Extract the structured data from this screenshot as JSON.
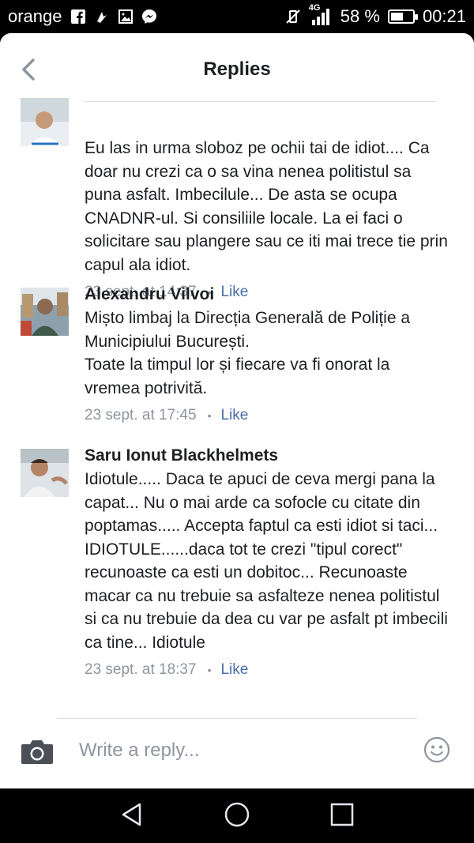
{
  "status_bar": {
    "carrier": "orange",
    "network": "4G",
    "battery_text": "58 %",
    "battery_level": 0.58,
    "time": "00:21"
  },
  "header": {
    "title": "Replies",
    "back_icon": "chevron-left-icon"
  },
  "comments": [
    {
      "author": "",
      "text": "Eu las in urma sloboz pe ochii tai de idiot.... Ca doar nu crezi ca o sa vina nenea politistul sa puna asfalt. Imbecilule... De asta se ocupa CNADNR-ul. Si consiliile locale. La ei faci o solicitare sau plangere sau ce iti mai trece tie prin capul ala idiot.",
      "time": "23 sept. at 14:37",
      "separator": "•",
      "like": "Like"
    },
    {
      "author": "Alexandru Vilvoi",
      "text": "Mișto limbaj la Direcția Generală de Poliție a Municipiului București.\nToate la timpul lor și fiecare va fi onorat la vremea potrivită.",
      "time": "23 sept. at 17:45",
      "separator": "•",
      "like": "Like"
    },
    {
      "author": "Saru Ionut Blackhelmets",
      "text": "Idiotule..... Daca te apuci de ceva mergi pana la capat... Nu o mai arde ca sofocle cu citate din poptamas..... Accepta faptul ca esti idiot si taci... IDIOTULE......daca tot te crezi \"tipul corect\" recunoaste ca esti un dobitoc... Recunoaste macar ca nu trebuie sa asfalteze nenea politistul si ca nu trebuie da dea cu var pe asfalt pt imbecili ca tine... Idiotule",
      "time": "23 sept. at 18:37",
      "separator": "•",
      "like": "Like"
    }
  ],
  "composer": {
    "placeholder": "Write a reply...",
    "left_icon": "camera-icon",
    "right_icon": "emoji-icon"
  },
  "nav_bar": {
    "icons": [
      "back-triangle-icon",
      "home-circle-icon",
      "recents-square-icon"
    ]
  },
  "colors": {
    "like": "#4a6ea9",
    "meta": "#8f959e",
    "text": "#1c1e21"
  }
}
